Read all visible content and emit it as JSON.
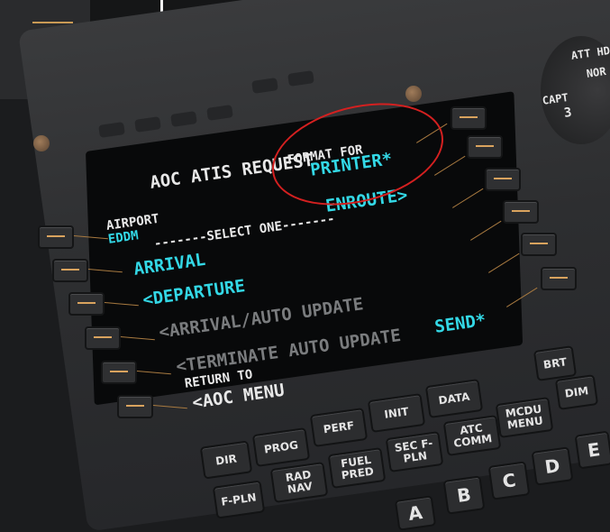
{
  "screen": {
    "title": "AOC ATIS REQUEST",
    "format_for_label": "FORMAT FOR",
    "printer": "PRINTER*",
    "airport_label": "AIRPORT",
    "airport_value": "EDDM",
    "select_one": "-------SELECT ONE-------",
    "enroute": "ENROUTE>",
    "arrival": "ARRIVAL",
    "departure": "<DEPARTURE",
    "arrival_auto_update": "<ARRIVAL/AUTO UPDATE",
    "terminate_auto_update": "<TERMINATE AUTO UPDATE",
    "send": "SEND*",
    "return_to_label": "RETURN TO",
    "aoc_menu": "<AOC MENU"
  },
  "keys": {
    "dir": "DIR",
    "prog": "PROG",
    "perf": "PERF",
    "init": "INIT",
    "data": "DATA",
    "fpln": "F-PLN",
    "radnav": "RAD NAV",
    "fuelpred": "FUEL PRED",
    "secfpln": "SEC F-PLN",
    "atccomm": "ATC COMM",
    "mcdumenu": "MCDU MENU",
    "brt": "BRT",
    "dim": "DIM",
    "a": "A",
    "b": "B",
    "c": "C",
    "d": "D",
    "e": "E"
  },
  "gauge": {
    "att_hdg": "ATT HD",
    "norm": "NOR",
    "capt": "CAPT",
    "capt_num": "3"
  }
}
